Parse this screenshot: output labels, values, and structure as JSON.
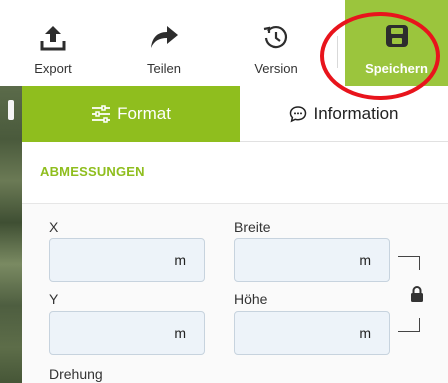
{
  "toolbar": {
    "export_label": "Export",
    "share_label": "Teilen",
    "version_label": "Version",
    "save_label": "Speichern",
    "accent_color": "#9bc53d",
    "highlight_color": "#e8141c"
  },
  "tabs": [
    {
      "label": "Format",
      "icon": "sliders-icon",
      "active": true
    },
    {
      "label": "Information",
      "icon": "chat-bubble-icon",
      "active": false
    }
  ],
  "section": {
    "title": "ABMESSUNGEN"
  },
  "fields": {
    "x": {
      "label": "X",
      "value": "",
      "unit": "m"
    },
    "width": {
      "label": "Breite",
      "value": "",
      "unit": "m"
    },
    "y": {
      "label": "Y",
      "value": "",
      "unit": "m"
    },
    "height": {
      "label": "Höhe",
      "value": "",
      "unit": "m"
    },
    "rotation": {
      "label": "Drehung"
    }
  },
  "aspect_lock": {
    "icon": "lock-icon",
    "locked": true
  }
}
